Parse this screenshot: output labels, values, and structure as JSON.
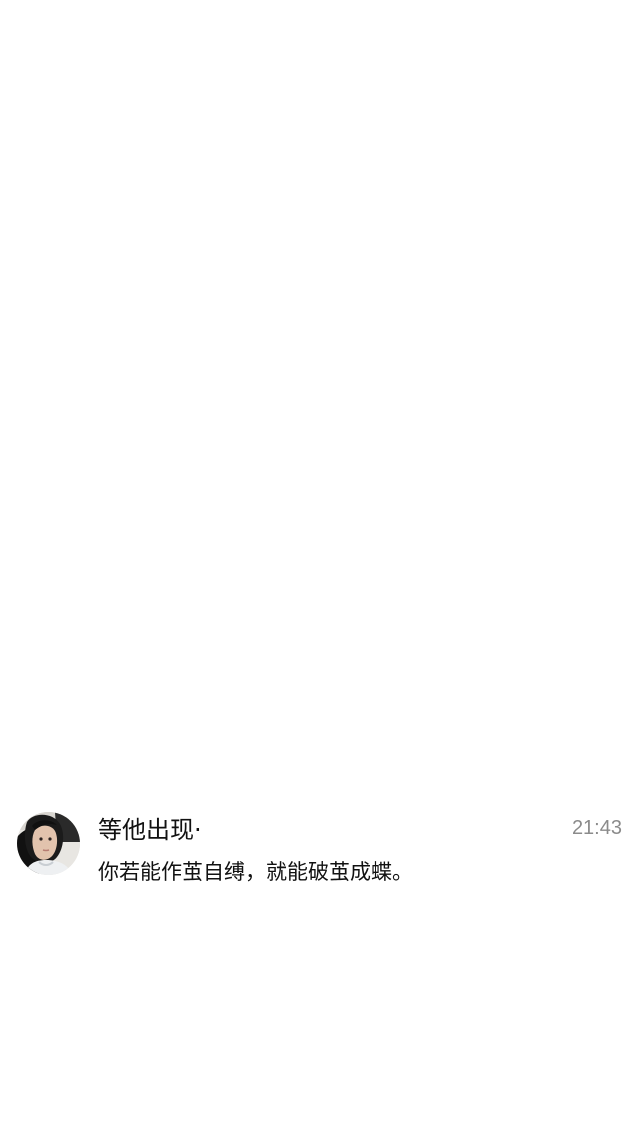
{
  "chat_list": {
    "item": {
      "avatar_icon": "user-avatar-photo",
      "name": "等他出现·",
      "time": "21:43",
      "message": "你若能作茧自缚，就能破茧成蝶。"
    }
  },
  "colors": {
    "background": "#ffffff",
    "name_text": "#111111",
    "time_text": "#8b8b8b"
  }
}
